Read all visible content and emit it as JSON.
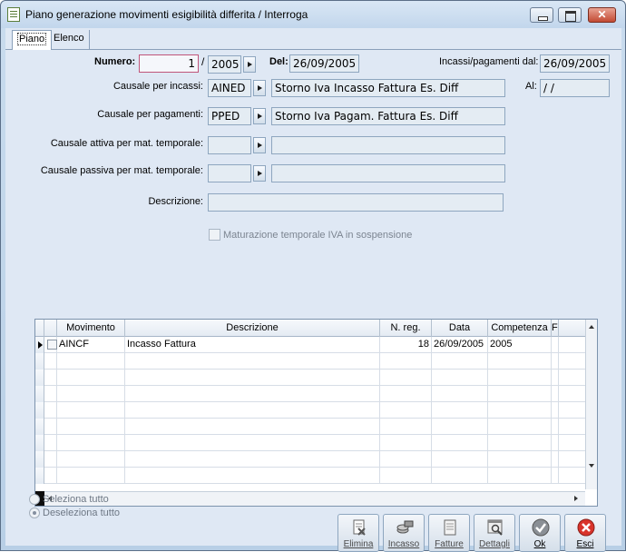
{
  "window": {
    "title": "Piano generazione movimenti esigibilità differita / Interroga"
  },
  "tabs": {
    "piano": "Piano",
    "elenco": "Elenco"
  },
  "form": {
    "numero_label": "Numero:",
    "numero_value": "1",
    "slash": "/",
    "anno_value": "2005",
    "del_label": "Del:",
    "del_value": "26/09/2005",
    "incassi_dal_label": "Incassi/pagamenti dal:",
    "incassi_dal_value": "26/09/2005",
    "al_label": "Al:",
    "al_value": "  /  /",
    "causale_incassi_label": "Causale per incassi:",
    "causale_incassi_code": "AINED",
    "causale_incassi_desc": "Storno Iva Incasso Fattura Es. Diff",
    "causale_pagamenti_label": "Causale per pagamenti:",
    "causale_pagamenti_code": "PPED",
    "causale_pagamenti_desc": "Storno Iva Pagam. Fattura Es. Diff",
    "causale_attiva_label": "Causale attiva per mat. temporale:",
    "causale_attiva_code": "",
    "causale_attiva_desc": "",
    "causale_passiva_label": "Causale passiva per mat. temporale:",
    "causale_passiva_code": "",
    "causale_passiva_desc": "",
    "descrizione_label": "Descrizione:",
    "descrizione_value": "",
    "maturazione_label": "Maturazione temporale IVA in sospensione"
  },
  "grid": {
    "headers": [
      "Movimento",
      "Descrizione",
      "N. reg.",
      "Data",
      "Competenza",
      "F"
    ],
    "rows": [
      {
        "movimento": "AINCF",
        "descrizione": "Incasso Fattura",
        "nreg": "18",
        "data": "26/09/2005",
        "competenza": "2005"
      }
    ]
  },
  "selection": {
    "seleziona_tutto": "Seleziona tutto",
    "deseleziona_tutto": "Deseleziona tutto"
  },
  "toolbar": {
    "elimina": "Elimina",
    "incasso": "Incasso",
    "fatture": "Fatture",
    "dettagli": "Dettagli",
    "ok": "Ok",
    "esci": "Esci"
  }
}
